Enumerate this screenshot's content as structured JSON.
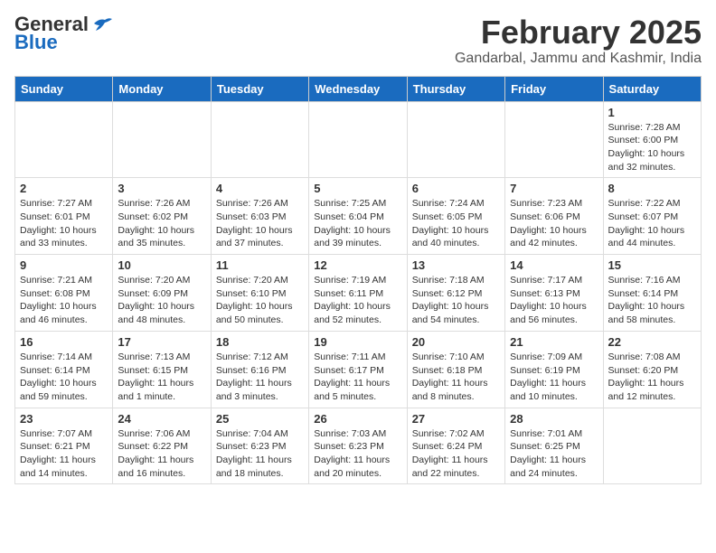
{
  "header": {
    "logo_general": "General",
    "logo_blue": "Blue",
    "month": "February 2025",
    "location": "Gandarbal, Jammu and Kashmir, India"
  },
  "weekdays": [
    "Sunday",
    "Monday",
    "Tuesday",
    "Wednesday",
    "Thursday",
    "Friday",
    "Saturday"
  ],
  "weeks": [
    [
      {
        "day": "",
        "info": ""
      },
      {
        "day": "",
        "info": ""
      },
      {
        "day": "",
        "info": ""
      },
      {
        "day": "",
        "info": ""
      },
      {
        "day": "",
        "info": ""
      },
      {
        "day": "",
        "info": ""
      },
      {
        "day": "1",
        "info": "Sunrise: 7:28 AM\nSunset: 6:00 PM\nDaylight: 10 hours and 32 minutes."
      }
    ],
    [
      {
        "day": "2",
        "info": "Sunrise: 7:27 AM\nSunset: 6:01 PM\nDaylight: 10 hours and 33 minutes."
      },
      {
        "day": "3",
        "info": "Sunrise: 7:26 AM\nSunset: 6:02 PM\nDaylight: 10 hours and 35 minutes."
      },
      {
        "day": "4",
        "info": "Sunrise: 7:26 AM\nSunset: 6:03 PM\nDaylight: 10 hours and 37 minutes."
      },
      {
        "day": "5",
        "info": "Sunrise: 7:25 AM\nSunset: 6:04 PM\nDaylight: 10 hours and 39 minutes."
      },
      {
        "day": "6",
        "info": "Sunrise: 7:24 AM\nSunset: 6:05 PM\nDaylight: 10 hours and 40 minutes."
      },
      {
        "day": "7",
        "info": "Sunrise: 7:23 AM\nSunset: 6:06 PM\nDaylight: 10 hours and 42 minutes."
      },
      {
        "day": "8",
        "info": "Sunrise: 7:22 AM\nSunset: 6:07 PM\nDaylight: 10 hours and 44 minutes."
      }
    ],
    [
      {
        "day": "9",
        "info": "Sunrise: 7:21 AM\nSunset: 6:08 PM\nDaylight: 10 hours and 46 minutes."
      },
      {
        "day": "10",
        "info": "Sunrise: 7:20 AM\nSunset: 6:09 PM\nDaylight: 10 hours and 48 minutes."
      },
      {
        "day": "11",
        "info": "Sunrise: 7:20 AM\nSunset: 6:10 PM\nDaylight: 10 hours and 50 minutes."
      },
      {
        "day": "12",
        "info": "Sunrise: 7:19 AM\nSunset: 6:11 PM\nDaylight: 10 hours and 52 minutes."
      },
      {
        "day": "13",
        "info": "Sunrise: 7:18 AM\nSunset: 6:12 PM\nDaylight: 10 hours and 54 minutes."
      },
      {
        "day": "14",
        "info": "Sunrise: 7:17 AM\nSunset: 6:13 PM\nDaylight: 10 hours and 56 minutes."
      },
      {
        "day": "15",
        "info": "Sunrise: 7:16 AM\nSunset: 6:14 PM\nDaylight: 10 hours and 58 minutes."
      }
    ],
    [
      {
        "day": "16",
        "info": "Sunrise: 7:14 AM\nSunset: 6:14 PM\nDaylight: 10 hours and 59 minutes."
      },
      {
        "day": "17",
        "info": "Sunrise: 7:13 AM\nSunset: 6:15 PM\nDaylight: 11 hours and 1 minute."
      },
      {
        "day": "18",
        "info": "Sunrise: 7:12 AM\nSunset: 6:16 PM\nDaylight: 11 hours and 3 minutes."
      },
      {
        "day": "19",
        "info": "Sunrise: 7:11 AM\nSunset: 6:17 PM\nDaylight: 11 hours and 5 minutes."
      },
      {
        "day": "20",
        "info": "Sunrise: 7:10 AM\nSunset: 6:18 PM\nDaylight: 11 hours and 8 minutes."
      },
      {
        "day": "21",
        "info": "Sunrise: 7:09 AM\nSunset: 6:19 PM\nDaylight: 11 hours and 10 minutes."
      },
      {
        "day": "22",
        "info": "Sunrise: 7:08 AM\nSunset: 6:20 PM\nDaylight: 11 hours and 12 minutes."
      }
    ],
    [
      {
        "day": "23",
        "info": "Sunrise: 7:07 AM\nSunset: 6:21 PM\nDaylight: 11 hours and 14 minutes."
      },
      {
        "day": "24",
        "info": "Sunrise: 7:06 AM\nSunset: 6:22 PM\nDaylight: 11 hours and 16 minutes."
      },
      {
        "day": "25",
        "info": "Sunrise: 7:04 AM\nSunset: 6:23 PM\nDaylight: 11 hours and 18 minutes."
      },
      {
        "day": "26",
        "info": "Sunrise: 7:03 AM\nSunset: 6:23 PM\nDaylight: 11 hours and 20 minutes."
      },
      {
        "day": "27",
        "info": "Sunrise: 7:02 AM\nSunset: 6:24 PM\nDaylight: 11 hours and 22 minutes."
      },
      {
        "day": "28",
        "info": "Sunrise: 7:01 AM\nSunset: 6:25 PM\nDaylight: 11 hours and 24 minutes."
      },
      {
        "day": "",
        "info": ""
      }
    ]
  ]
}
